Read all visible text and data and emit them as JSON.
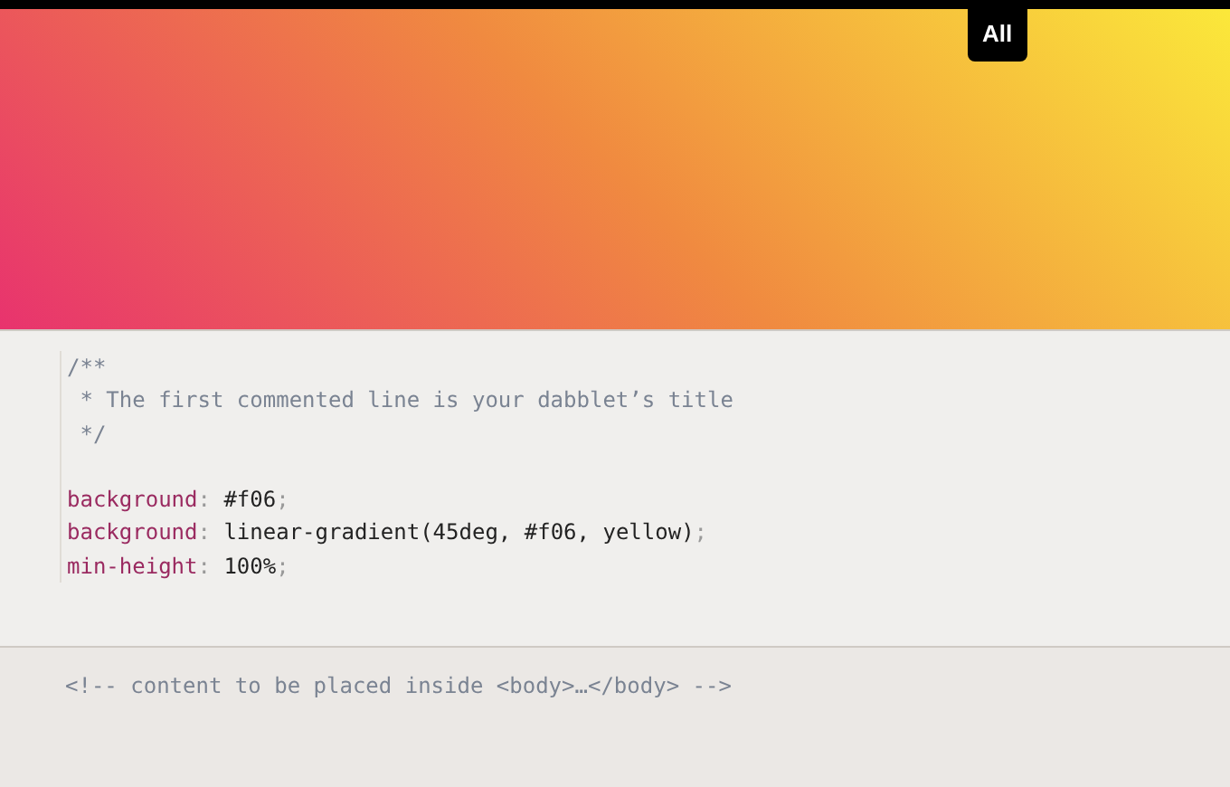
{
  "view_tabs": [
    {
      "label": "All",
      "selected": true
    }
  ],
  "css_editor": {
    "lines": [
      {
        "kind": "comment",
        "text": "/**"
      },
      {
        "kind": "comment",
        "text": " * The first commented line is your dabblet’s title"
      },
      {
        "kind": "comment",
        "text": " */"
      },
      {
        "kind": "blank"
      },
      {
        "kind": "declaration",
        "property": "background",
        "colon": ":",
        "value": " #f06",
        "semicolon": ";"
      },
      {
        "kind": "declaration",
        "property": "background",
        "colon": ":",
        "value": " linear-gradient(45deg, #f06, yellow)",
        "semicolon": ";"
      },
      {
        "kind": "declaration",
        "property": "min-height",
        "colon": ":",
        "value": " 100%",
        "semicolon": ";"
      }
    ]
  },
  "html_editor": {
    "lines": [
      {
        "kind": "comment",
        "text": "<!-- content to be placed inside <body>…</body> -->"
      }
    ]
  }
}
